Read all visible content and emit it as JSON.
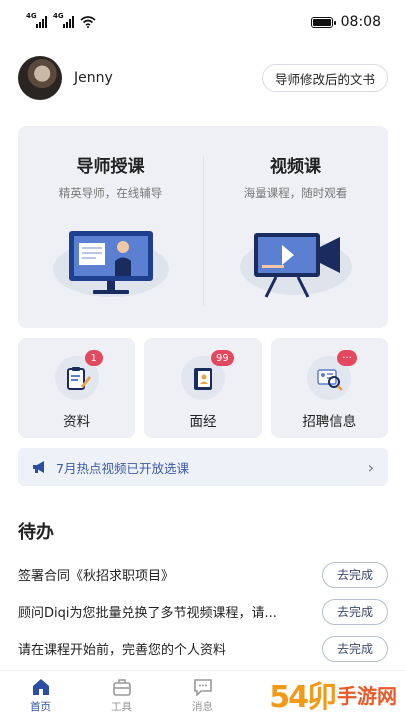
{
  "status_bar": {
    "time": "08:08",
    "network_1": "4G",
    "network_2": "4G"
  },
  "profile": {
    "name": "Jenny",
    "tag_button": "导师修改后的文书"
  },
  "hero": {
    "left": {
      "title": "导师授课",
      "subtitle": "精英导师，在线辅导"
    },
    "right": {
      "title": "视频课",
      "subtitle": "海量课程，随时观看"
    }
  },
  "cards": [
    {
      "label": "资料",
      "badge": "1",
      "icon": "clipboard-pencil-icon"
    },
    {
      "label": "面经",
      "badge": "99",
      "icon": "book-icon"
    },
    {
      "label": "招聘信息",
      "badge": "···",
      "icon": "resume-search-icon"
    }
  ],
  "notice": {
    "text": "7月热点视频已开放选课",
    "icon": "megaphone-icon"
  },
  "todo": {
    "title": "待办",
    "items": [
      {
        "text": "签署合同《秋招求职项目》",
        "action": "去完成"
      },
      {
        "text": "顾问Diqi为您批量兑换了多节视频课程，请...",
        "action": "去完成"
      },
      {
        "text": "请在课程开始前，完善您的个人资料",
        "action": "去完成"
      }
    ]
  },
  "tabs": [
    {
      "label": "首页",
      "icon": "home-icon",
      "active": true
    },
    {
      "label": "工具",
      "icon": "toolbox-icon",
      "active": false
    },
    {
      "label": "消息",
      "icon": "message-icon",
      "active": false
    }
  ],
  "watermark": {
    "num": "54卯",
    "txt": "手游网"
  },
  "colors": {
    "accent": "#2c4fa3",
    "badge": "#e4485e",
    "card_bg": "#eef0f5"
  }
}
